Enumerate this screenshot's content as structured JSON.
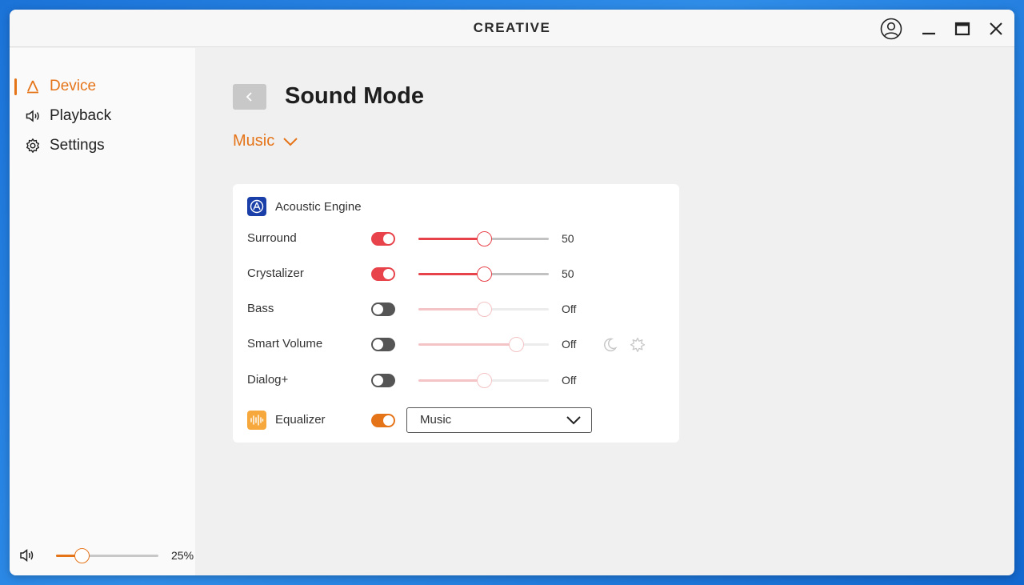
{
  "app": {
    "brand": "CREATIVE"
  },
  "colors": {
    "accent": "#e57419",
    "slider_active": "#e8424a",
    "toggle_off": "#555555",
    "engine_badge": "#1a3fa8",
    "eq_badge": "#f6a83c"
  },
  "icons": {
    "account": "user-circle-icon",
    "minimize": "minimize-icon",
    "maximize": "maximize-icon",
    "close": "close-icon"
  },
  "sidebar": {
    "items": [
      {
        "label": "Device",
        "icon": "device-icon",
        "active": true
      },
      {
        "label": "Playback",
        "icon": "speaker-icon",
        "active": false
      },
      {
        "label": "Settings",
        "icon": "gear-icon",
        "active": false
      }
    ],
    "volume": {
      "percent_label": "25%",
      "level": 0.25
    }
  },
  "main": {
    "title": "Sound Mode",
    "mode": "Music",
    "engine": {
      "title": "Acoustic Engine",
      "rows": [
        {
          "name": "Surround",
          "enabled": true,
          "value": 50,
          "display": "50"
        },
        {
          "name": "Crystalizer",
          "enabled": true,
          "value": 50,
          "display": "50"
        },
        {
          "name": "Bass",
          "enabled": false,
          "value": 50,
          "display": "Off"
        },
        {
          "name": "Smart Volume",
          "enabled": false,
          "value": 75,
          "display": "Off"
        },
        {
          "name": "Dialog+",
          "enabled": false,
          "value": 50,
          "display": "Off"
        }
      ]
    },
    "equalizer": {
      "name": "Equalizer",
      "enabled": true,
      "preset": "Music"
    }
  }
}
